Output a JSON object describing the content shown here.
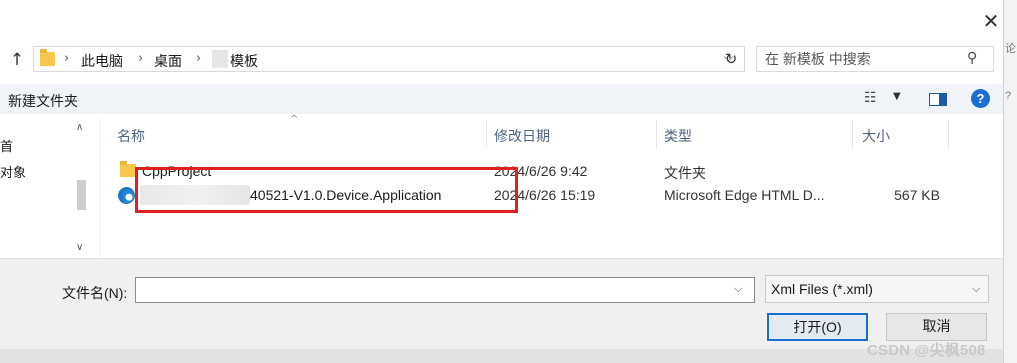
{
  "window": {
    "close_glyph": "✕"
  },
  "address": {
    "up_glyph": "↑",
    "crumbs": [
      "此电脑",
      "桌面",
      "模板"
    ],
    "sep_glyph": "›",
    "dropdown_glyph": "⌵",
    "refresh_glyph": "↻",
    "search_placeholder": "在 新模板 中搜索",
    "search_glyph": "⚲"
  },
  "toolbar": {
    "new_folder_label": "新建文件夹",
    "view_glyph": "☷",
    "view_arrow": "▼",
    "help_glyph": "?"
  },
  "nav_pane": {
    "items": [
      "首",
      "对象"
    ],
    "up_glyph": "∧",
    "down_glyph": "∨"
  },
  "file_list": {
    "sort_glyph": "^",
    "columns": [
      "名称",
      "修改日期",
      "类型",
      "大小"
    ],
    "rows": [
      {
        "name": "CppProject",
        "date": "2024/6/26 9:42",
        "type": "文件夹",
        "size": ""
      },
      {
        "name": "40521-V1.0.Device.Application",
        "date": "2024/6/26 15:19",
        "type": "Microsoft Edge HTML D...",
        "size": "567 KB"
      }
    ]
  },
  "bottom": {
    "filename_label": "文件名(N):",
    "filename_value": "",
    "filename_arrow": "⌵",
    "filter_value": "Xml Files (*.xml)",
    "filter_arrow": "⌵",
    "open_label": "打开(O)",
    "cancel_label": "取消"
  },
  "watermark": "CSDN @尖枫508",
  "edge_fragments": [
    "论",
    "?"
  ],
  "colors": {
    "accent": "#1a6fd1",
    "highlight": "#e02020",
    "folder": "#f6c94d"
  }
}
